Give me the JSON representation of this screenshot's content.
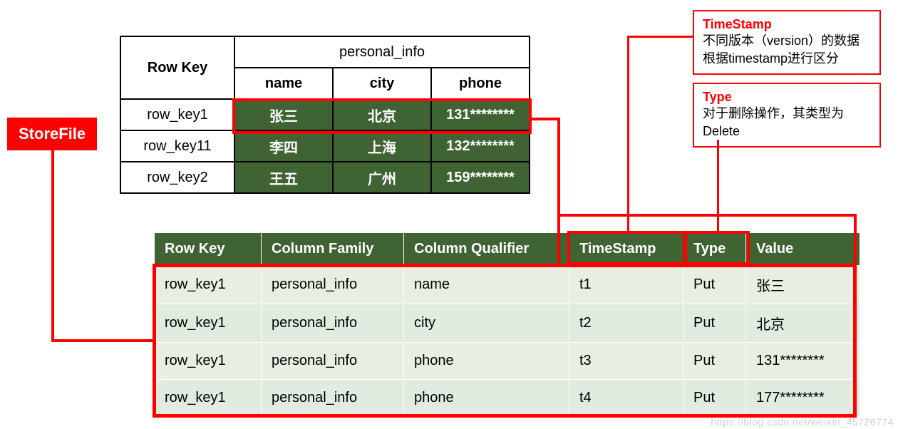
{
  "labels": {
    "storefile": "StoreFile"
  },
  "callouts": {
    "timestamp": {
      "title": "TimeStamp",
      "desc": "不同版本（version）的数据根据timestamp进行区分"
    },
    "type": {
      "title": "Type",
      "desc": "对于删除操作，其类型为Delete"
    }
  },
  "upper_table": {
    "column_family": "personal_info",
    "rowkey_header": "Row Key",
    "qualifiers": [
      "name",
      "city",
      "phone"
    ],
    "rows": [
      {
        "rk": "row_key1",
        "cells": [
          "张三",
          "北京",
          "131********"
        ]
      },
      {
        "rk": "row_key11",
        "cells": [
          "李四",
          "上海",
          "132********"
        ]
      },
      {
        "rk": "row_key2",
        "cells": [
          "王五",
          "广州",
          "159********"
        ]
      }
    ]
  },
  "lower_table": {
    "headers": [
      "Row Key",
      "Column Family",
      "Column Qualifier",
      "TimeStamp",
      "Type",
      "Value"
    ],
    "rows": [
      {
        "rk": "row_key1",
        "cf": "personal_info",
        "cq": "name",
        "ts": "t1",
        "type": "Put",
        "val": "张三"
      },
      {
        "rk": "row_key1",
        "cf": "personal_info",
        "cq": "city",
        "ts": "t2",
        "type": "Put",
        "val": "北京"
      },
      {
        "rk": "row_key1",
        "cf": "personal_info",
        "cq": "phone",
        "ts": "t3",
        "type": "Put",
        "val": "131********"
      },
      {
        "rk": "row_key1",
        "cf": "personal_info",
        "cq": "phone",
        "ts": "t4",
        "type": "Put",
        "val": "177********"
      }
    ]
  },
  "watermark": "https://blog.csdn.net/weixin_45726774"
}
